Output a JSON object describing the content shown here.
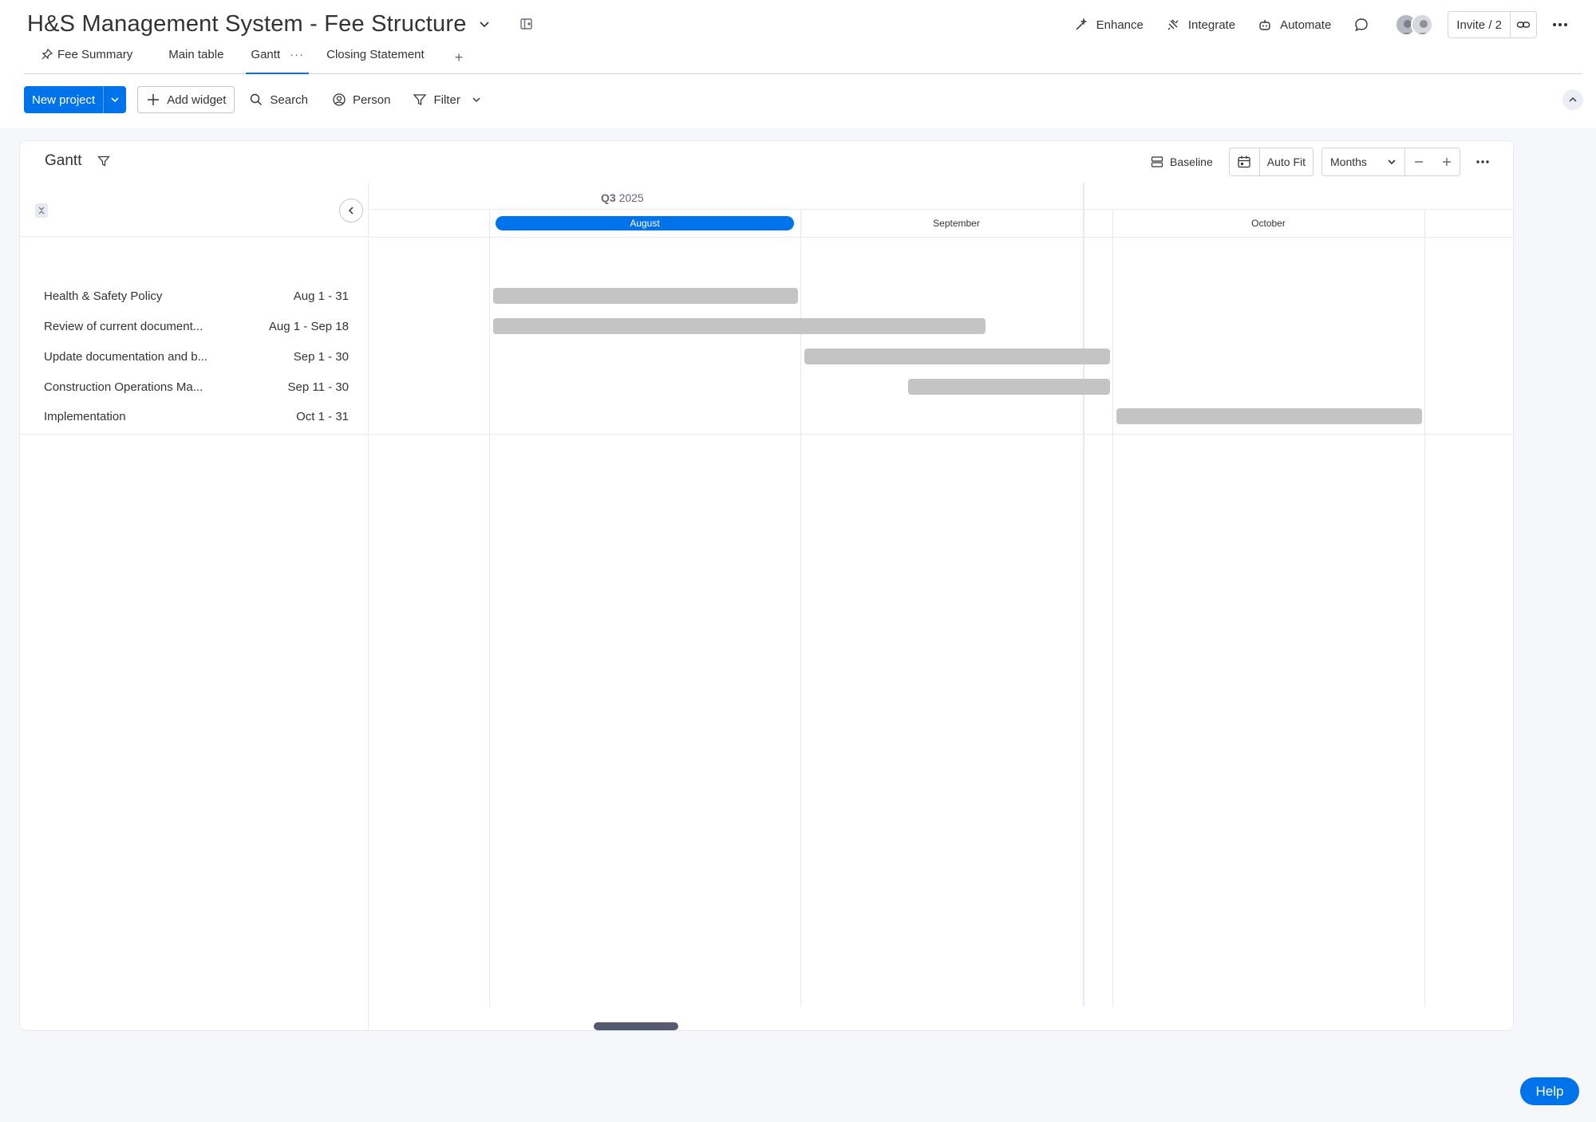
{
  "header": {
    "board_title": "H&S Management System - Fee Structure",
    "actions": {
      "enhance": "Enhance",
      "integrate": "Integrate",
      "automate": "Automate"
    },
    "invite_label": "Invite / 2"
  },
  "tabs": [
    {
      "label": "Fee Summary",
      "icon": "pin-icon"
    },
    {
      "label": "Main table"
    },
    {
      "label": "Gantt",
      "active": true
    },
    {
      "label": "Closing Statement"
    }
  ],
  "tab_add": "+",
  "toolbar": {
    "new_project": "New project",
    "add_widget": "Add widget",
    "search": "Search",
    "person": "Person",
    "filter": "Filter"
  },
  "gantt": {
    "title": "Gantt",
    "baseline": "Baseline",
    "auto_fit": "Auto Fit",
    "zoom_select": "Months",
    "quarter_bold": "Q3",
    "quarter_year": "2025",
    "months": [
      {
        "label": "August",
        "current": true
      },
      {
        "label": "September"
      },
      {
        "label": "October"
      }
    ],
    "tasks": [
      {
        "name": "Health & Safety Policy",
        "dates": "Aug 1 - 31",
        "start": "2025-08-01",
        "end": "2025-08-31"
      },
      {
        "name": "Review of current document...",
        "dates": "Aug 1 - Sep 18",
        "start": "2025-08-01",
        "end": "2025-09-18"
      },
      {
        "name": "Update documentation and b...",
        "dates": "Sep 1 - 30",
        "start": "2025-09-01",
        "end": "2025-09-30"
      },
      {
        "name": "Construction Operations Ma...",
        "dates": "Sep 11 - 30",
        "start": "2025-09-11",
        "end": "2025-09-30"
      },
      {
        "name": "Implementation",
        "dates": "Oct 1 - 31",
        "start": "2025-10-01",
        "end": "2025-10-31"
      }
    ],
    "bar_color": "#c4c4c4",
    "current_month_color": "#0073ea"
  },
  "help_label": "Help",
  "colors": {
    "accent": "#0073ea"
  }
}
